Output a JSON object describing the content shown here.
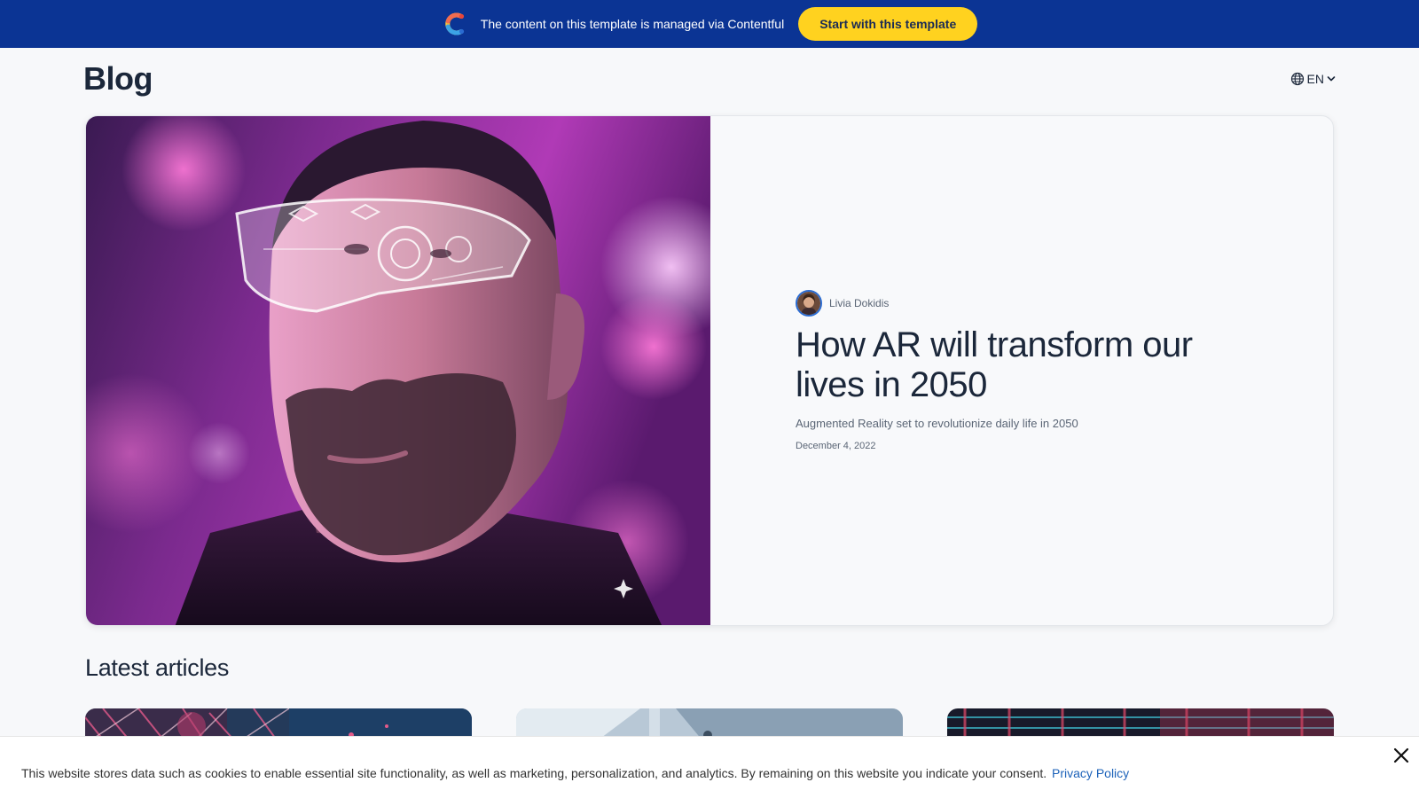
{
  "banner": {
    "logo_icon": "contentful-logo-icon",
    "text": "The content on this template is managed via Contentful",
    "cta_label": "Start with this template",
    "background": "#0b3494",
    "cta_color": "#ffd21f"
  },
  "header": {
    "title": "Blog",
    "language_icon": "globe-icon",
    "language": "EN"
  },
  "featured": {
    "author": "Livia Dokidis",
    "title": "How AR will transform our lives in 2050",
    "subtitle": "Augmented Reality set to revolutionize daily life in 2050",
    "date": "December 4, 2022"
  },
  "latest": {
    "heading": "Latest articles"
  },
  "cookie": {
    "text": "This website stores data such as cookies to enable essential site functionality, as well as marketing, personalization, and analytics. By remaining on this website you indicate your consent.",
    "link_label": "Privacy Policy",
    "close_icon": "close-icon"
  }
}
